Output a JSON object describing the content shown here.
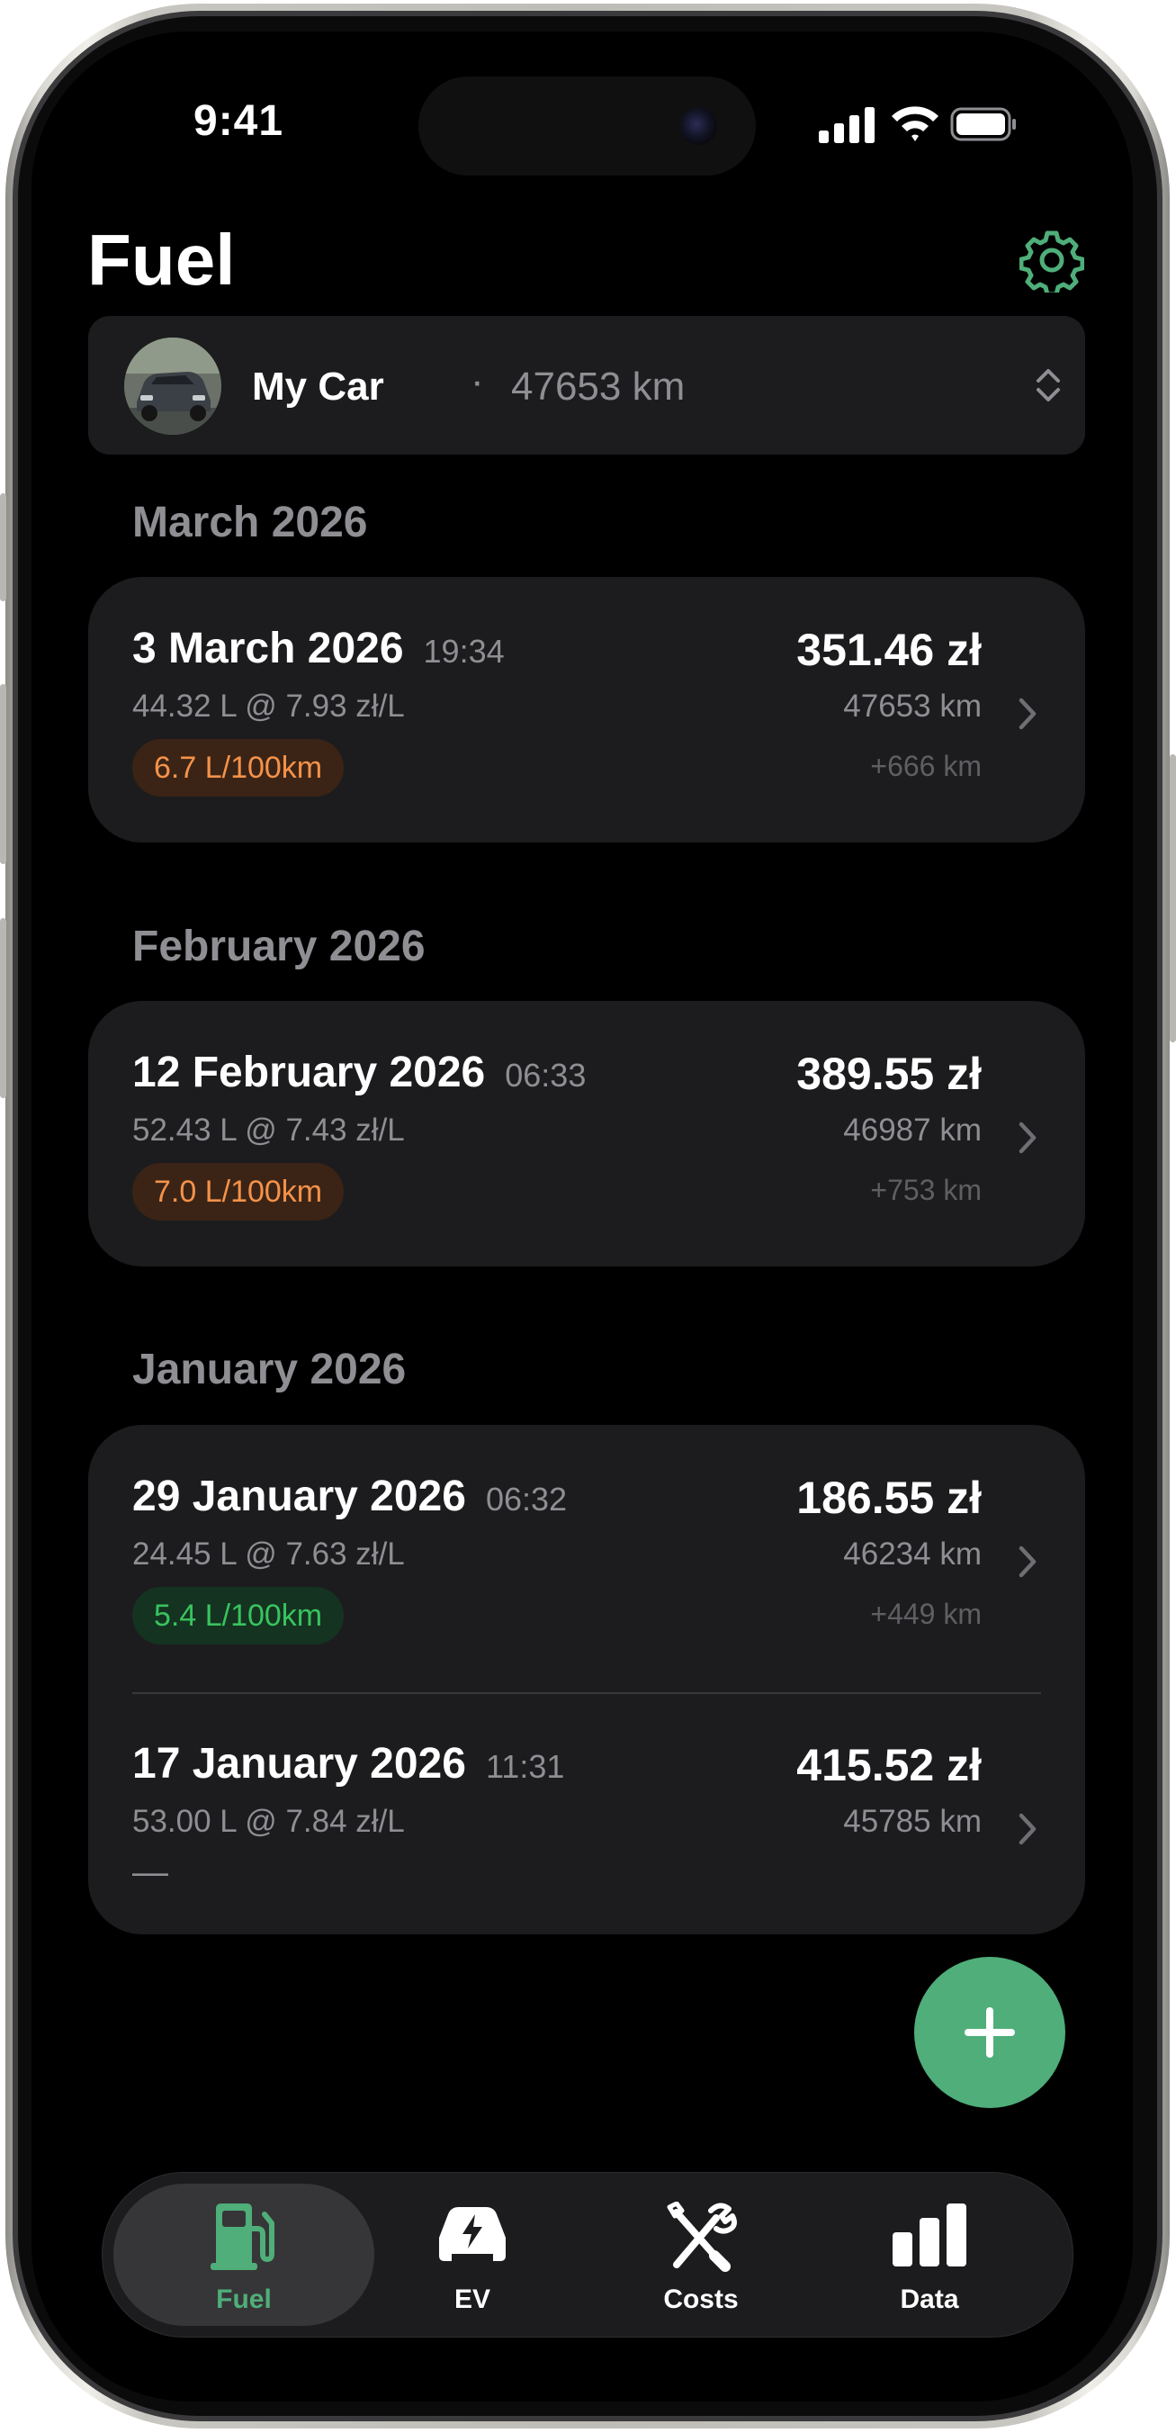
{
  "status_bar": {
    "time": "9:41"
  },
  "header": {
    "title": "Fuel"
  },
  "vehicle": {
    "name": "My Car",
    "separator": "·",
    "odometer": "47653 km"
  },
  "sections": [
    {
      "title": "March 2026",
      "entries": [
        {
          "date": "3 March 2026",
          "time": "19:34",
          "volume": "44.32 L @ 7.93 zł/L",
          "consumption": "6.7 L/100km",
          "consumption_level": "orange",
          "price": "351.46 zł",
          "odometer": "47653 km",
          "distance": "+666 km"
        }
      ]
    },
    {
      "title": "February 2026",
      "entries": [
        {
          "date": "12 February 2026",
          "time": "06:33",
          "volume": "52.43 L @ 7.43 zł/L",
          "consumption": "7.0 L/100km",
          "consumption_level": "orange",
          "price": "389.55 zł",
          "odometer": "46987 km",
          "distance": "+753 km"
        }
      ]
    },
    {
      "title": "January 2026",
      "entries": [
        {
          "date": "29 January 2026",
          "time": "06:32",
          "volume": "24.45 L @ 7.63 zł/L",
          "consumption": "5.4 L/100km",
          "consumption_level": "green",
          "price": "186.55 zł",
          "odometer": "46234 km",
          "distance": "+449 km"
        },
        {
          "date": "17 January 2026",
          "time": "11:31",
          "volume": "53.00 L @ 7.84 zł/L",
          "consumption": "—",
          "consumption_level": "none",
          "price": "415.52 zł",
          "odometer": "45785 km",
          "distance": ""
        }
      ]
    }
  ],
  "tabs": [
    {
      "label": "Fuel",
      "icon": "fuel-pump-icon",
      "active": true
    },
    {
      "label": "EV",
      "icon": "ev-car-icon",
      "active": false
    },
    {
      "label": "Costs",
      "icon": "wrench-screwdriver-icon",
      "active": false
    },
    {
      "label": "Data",
      "icon": "bar-chart-icon",
      "active": false
    }
  ],
  "colors": {
    "accent": "#4fae79",
    "orange_badge_text": "#f5924a",
    "green_badge_text": "#39c35e",
    "card_bg": "#1c1c1e",
    "background": "#000000"
  },
  "icons": {
    "settings": "gear-icon",
    "vehicle_picker": "chevron-up-down-icon",
    "row_disclosure": "chevron-right-icon",
    "add": "plus-icon"
  }
}
